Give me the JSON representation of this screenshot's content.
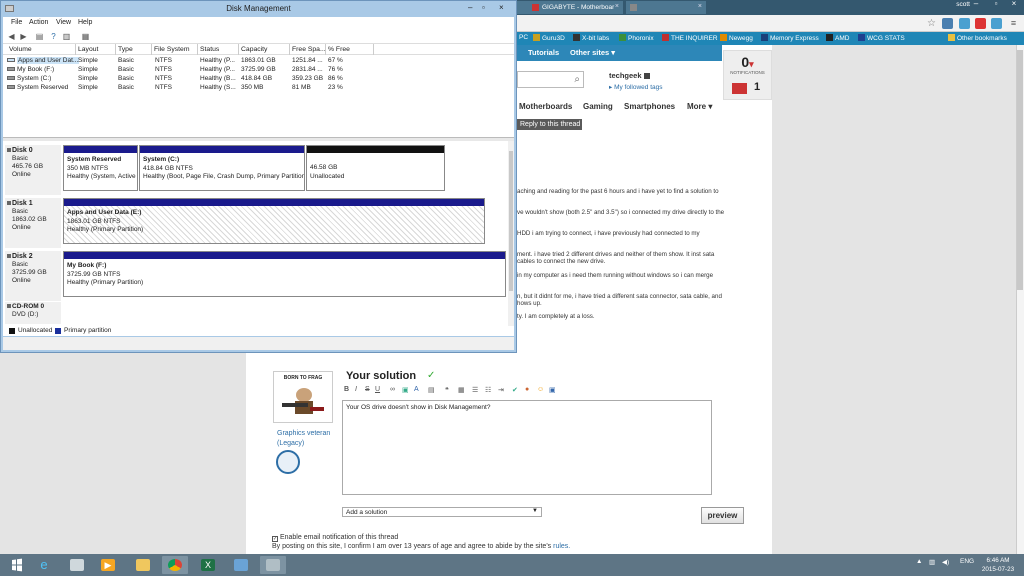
{
  "browser": {
    "tabs": [
      {
        "label": "GIGABYTE - Motherboar"
      },
      {
        "label": ""
      }
    ],
    "user": "scott",
    "bookmarks": [
      {
        "label": "PC",
        "color": "#2f6aa0"
      },
      {
        "label": "Guru3D",
        "color": "#c8a020"
      },
      {
        "label": "X-bit labs",
        "color": "#333333"
      },
      {
        "label": "Phoronix",
        "color": "#3b8f3b"
      },
      {
        "label": "THE INQUIRER",
        "color": "#c03030"
      },
      {
        "label": "Newegg",
        "color": "#e08a00"
      },
      {
        "label": "Memory Express",
        "color": "#1a3f7a"
      },
      {
        "label": "AMD",
        "color": "#222222"
      },
      {
        "label": "WCG STATS",
        "color": "#1f3f8f"
      }
    ],
    "other_bookmarks": "Other bookmarks"
  },
  "site": {
    "nav": [
      "Tutorials",
      "Other sites ▾"
    ],
    "username": "techgeek",
    "followed_tags": "My followed tags",
    "notifications_count": "0",
    "notifications_label": "NOTIFICATIONS",
    "messages_count": "1",
    "categories": [
      "Motherboards",
      "Gaming",
      "Smartphones",
      "More ▾"
    ],
    "reply_tag": "Reply to this thread",
    "post_lines": [
      "aching and reading for the past 6 hours and i have yet to find a solution to",
      "ve wouldn't show (both 2.5\" and 3.5\") so i connected my drive directly to the",
      "HDD i am trying to connect, i have previously had connected to my",
      "ment. i have tried 2 different drives and neither of them show. It inst sata",
      "cables to connect the new drive.",
      "in my computer as i need them running without windows so i can merge",
      "n, but it didnt for me, i have tried a different sata connector, sata cable, and",
      "hows up.",
      "ty. I am completely at a loss."
    ],
    "avatar_caption": "BORN TO FRAG",
    "rank_line1": "Graphics veteran",
    "rank_line2": "(Legacy)",
    "solution_title": "Your solution",
    "editor_text": "Your OS drive doesn't show in Disk Management?",
    "add_solution": "Add a solution",
    "preview": "preview",
    "notify_label": "Enable email notification of this thread",
    "agree_text": "By posting on this site, I confirm I am over 13 years of age and agree to abide by the site's",
    "rules_link": "rules."
  },
  "dm": {
    "title": "Disk Management",
    "menu": [
      "File",
      "Action",
      "View",
      "Help"
    ],
    "columns": [
      "Volume",
      "Layout",
      "Type",
      "File System",
      "Status",
      "Capacity",
      "Free Spa...",
      "% Free"
    ],
    "volumes": [
      [
        "Apps and User Dat...",
        "Simple",
        "Basic",
        "NTFS",
        "Healthy (P...",
        "1863.01 GB",
        "1251.84 ...",
        "67 %"
      ],
      [
        "My Book (F:)",
        "Simple",
        "Basic",
        "NTFS",
        "Healthy (P...",
        "3725.99 GB",
        "2831.84 ...",
        "76 %"
      ],
      [
        "System (C:)",
        "Simple",
        "Basic",
        "NTFS",
        "Healthy (B...",
        "418.84 GB",
        "359.23 GB",
        "86 %"
      ],
      [
        "System Reserved",
        "Simple",
        "Basic",
        "NTFS",
        "Healthy (S...",
        "350 MB",
        "81 MB",
        "23 %"
      ]
    ],
    "disks": [
      {
        "name": "Disk 0",
        "type": "Basic",
        "size": "465.76 GB",
        "state": "Online",
        "parts": [
          {
            "name": "System Reserved",
            "size": "350 MB NTFS",
            "status": "Healthy (System, Active"
          },
          {
            "name": "System (C:)",
            "size": "418.84 GB NTFS",
            "status": "Healthy (Boot, Page File, Crash Dump, Primary Partition)"
          },
          {
            "size": "46.58 GB",
            "status": "Unallocated"
          }
        ]
      },
      {
        "name": "Disk 1",
        "type": "Basic",
        "size": "1863.02 GB",
        "state": "Online",
        "parts": [
          {
            "name": "Apps and User Data (E:)",
            "size": "1863.01 GB NTFS",
            "status": "Healthy (Primary Partition)"
          }
        ]
      },
      {
        "name": "Disk 2",
        "type": "Basic",
        "size": "3725.99 GB",
        "state": "Online",
        "parts": [
          {
            "name": "My Book (F:)",
            "size": "3725.99 GB NTFS",
            "status": "Healthy (Primary Partition)"
          }
        ]
      }
    ],
    "cdrom": {
      "name": "CD-ROM 0",
      "drive": "DVD (D:)"
    },
    "legend": [
      {
        "label": "Unallocated",
        "color": "#111111"
      },
      {
        "label": "Primary partition",
        "color": "#1a2f9c"
      }
    ],
    "primary_color": "#1a1a8c",
    "unalloc_color": "#111111"
  },
  "taskbar": {
    "apps": [
      "start",
      "internet-explorer",
      "file-manager",
      "media-player",
      "folder",
      "chrome",
      "excel",
      "network",
      "disk-management"
    ],
    "tray_lang": "ENG",
    "time": "6:46 AM",
    "date": "2015-07-23"
  }
}
